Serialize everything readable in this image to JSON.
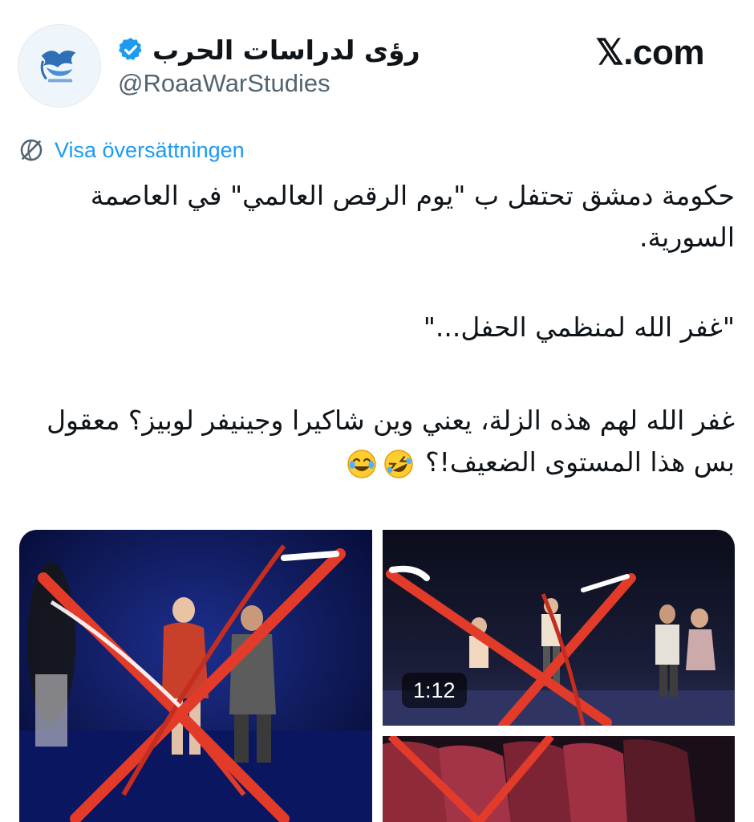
{
  "header": {
    "display_name": "رؤى لدراسات الحرب",
    "handle": "@RoaaWarStudies",
    "site_label": "𝕏.com",
    "verified_icon": "verified-badge-icon",
    "accent_color": "#1d9bf0"
  },
  "translate": {
    "label": "Visa översättningen",
    "icon": "globe-translate-icon"
  },
  "tweet": {
    "paragraph_1": "حكومة دمشق تحتفل ب \"يوم الرقص العالمي\" في العاصمة السورية.",
    "paragraph_2": "\"غفر الله لمنظمي الحفل...\"",
    "paragraph_3": "غفر الله لهم هذه الزلة، يعني وين شاكيرا وجينيفر لوبيز؟ معقول بس هذا المستوى الضعيف!؟",
    "emojis": [
      "rolling-on-floor-laughing",
      "face-with-tears-of-joy"
    ]
  },
  "media": {
    "video_duration": "1:12",
    "items": [
      "dance-performance-photo-1",
      "dance-performance-video",
      "dance-performance-photo-3"
    ]
  }
}
